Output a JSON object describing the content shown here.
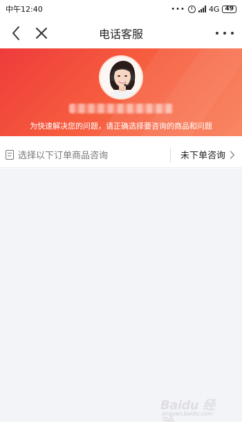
{
  "status_bar": {
    "time": "中午12:40",
    "dots": "•••",
    "network": "4G",
    "battery": "49"
  },
  "header": {
    "title": "电话客服"
  },
  "banner": {
    "note": "为快速解决您的问题，请正确选择要咨询的商品和问题"
  },
  "order_row": {
    "left_label": "选择以下订单商品咨询",
    "right_label": "未下单咨询"
  },
  "watermark": {
    "brand": "Baidu 经验",
    "sub": "jingyan.baidu.com"
  },
  "colors": {
    "banner_start": "#ee3b3b",
    "banner_end": "#f9805a",
    "content_bg": "#f3f4f8"
  }
}
